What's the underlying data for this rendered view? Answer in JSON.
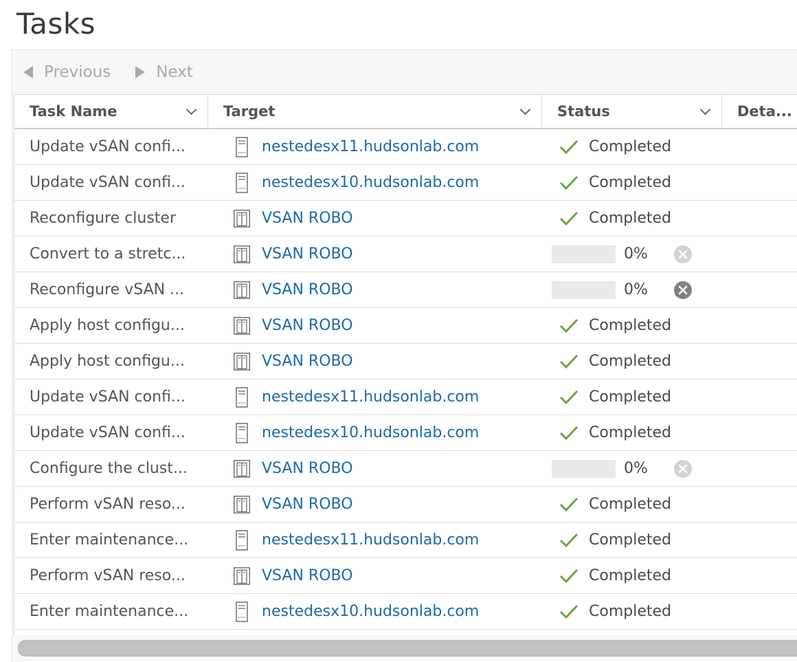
{
  "page": {
    "title": "Tasks"
  },
  "pager": {
    "previous_label": "Previous",
    "next_label": "Next"
  },
  "columns": {
    "task_name": "Task Name",
    "target": "Target",
    "status": "Status",
    "details": "Deta..."
  },
  "colors": {
    "link": "#1a6bab",
    "check": "#6aa53a",
    "disabled": "#a9a9a9"
  },
  "rows": [
    {
      "task": "Update vSAN confi...",
      "target": "nestedesx11.hudsonlab.com",
      "target_icon": "host-icon",
      "status": "Completed",
      "progress": null,
      "cancel": null
    },
    {
      "task": "Update vSAN confi...",
      "target": "nestedesx10.hudsonlab.com",
      "target_icon": "host-icon",
      "status": "Completed",
      "progress": null,
      "cancel": null
    },
    {
      "task": "Reconfigure cluster",
      "target": "VSAN ROBO",
      "target_icon": "cluster-icon",
      "status": "Completed",
      "progress": null,
      "cancel": null
    },
    {
      "task": "Convert to a stretc...",
      "target": "VSAN ROBO",
      "target_icon": "cluster-icon",
      "status": "0%",
      "progress": 0,
      "cancel": "disabled"
    },
    {
      "task": "Reconfigure vSAN ...",
      "target": "VSAN ROBO",
      "target_icon": "cluster-icon",
      "status": "0%",
      "progress": 0,
      "cancel": "active"
    },
    {
      "task": "Apply host configu...",
      "target": "VSAN ROBO",
      "target_icon": "cluster-icon",
      "status": "Completed",
      "progress": null,
      "cancel": null
    },
    {
      "task": "Apply host configu...",
      "target": "VSAN ROBO",
      "target_icon": "cluster-icon",
      "status": "Completed",
      "progress": null,
      "cancel": null
    },
    {
      "task": "Update vSAN confi...",
      "target": "nestedesx11.hudsonlab.com",
      "target_icon": "host-icon",
      "status": "Completed",
      "progress": null,
      "cancel": null
    },
    {
      "task": "Update vSAN confi...",
      "target": "nestedesx10.hudsonlab.com",
      "target_icon": "host-icon",
      "status": "Completed",
      "progress": null,
      "cancel": null
    },
    {
      "task": "Configure the clust...",
      "target": "VSAN ROBO",
      "target_icon": "cluster-icon",
      "status": "0%",
      "progress": 0,
      "cancel": "disabled"
    },
    {
      "task": "Perform vSAN reso...",
      "target": "VSAN ROBO",
      "target_icon": "cluster-icon",
      "status": "Completed",
      "progress": null,
      "cancel": null
    },
    {
      "task": "Enter maintenance...",
      "target": "nestedesx11.hudsonlab.com",
      "target_icon": "host-icon",
      "status": "Completed",
      "progress": null,
      "cancel": null
    },
    {
      "task": "Perform vSAN reso...",
      "target": "VSAN ROBO",
      "target_icon": "cluster-icon",
      "status": "Completed",
      "progress": null,
      "cancel": null
    },
    {
      "task": "Enter maintenance...",
      "target": "nestedesx10.hudsonlab.com",
      "target_icon": "host-icon",
      "status": "Completed",
      "progress": null,
      "cancel": null
    }
  ]
}
